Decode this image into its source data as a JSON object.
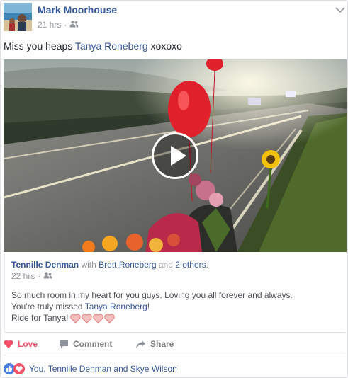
{
  "post": {
    "author": "Mark Moorhouse",
    "time": "21 hrs",
    "privacy_icon": "friends-icon",
    "text_prefix": "Miss you heaps ",
    "tagged": "Tanya Roneberg",
    "text_suffix": " xoxoxo"
  },
  "video": {
    "play_icon": "play-icon"
  },
  "shared": {
    "author": "Tennille Denman",
    "with_text": " with ",
    "with_name": "Brett Roneberg",
    "and_text": " and ",
    "others": "2 others",
    "period": ".",
    "time": "22 hrs",
    "line1": "So much room in my heart for you guys. Loving you all forever and always.",
    "line2_prefix": "You're truly missed ",
    "line2_tag": "Tanya Roneberg",
    "line2_suffix": "!",
    "line3": "Ride for Tanya!"
  },
  "actions": {
    "love": "Love",
    "comment": "Comment",
    "share": "Share"
  },
  "reactions": {
    "text": "You, Tennille Denman and Skye Wilson"
  },
  "colors": {
    "link": "#365899",
    "love": "#f25268",
    "meta": "#90949c"
  }
}
